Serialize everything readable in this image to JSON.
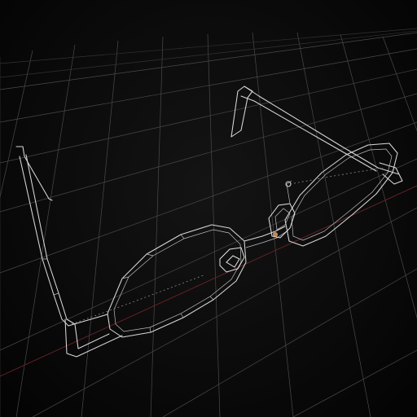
{
  "viewport": {
    "background": "#050505",
    "grid_color": "#4a4a4a",
    "axis_color": "#6a2428",
    "wire_color": "#d8d8d8",
    "accent_color": "#c9834a"
  },
  "scene": {
    "object": "eyeglasses-wireframe",
    "render_mode": "wireframe",
    "grid": true,
    "x_axis_visible": true
  }
}
